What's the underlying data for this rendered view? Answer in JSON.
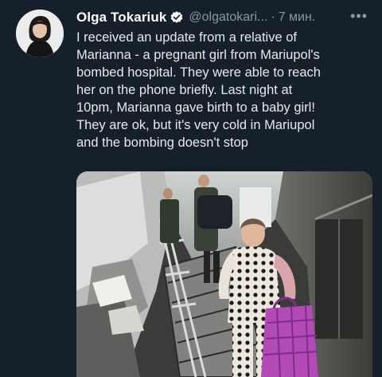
{
  "tweet": {
    "author_name": "Olga Tokariuk",
    "handle": "@olgatokari...",
    "separator": "·",
    "time": "7 мин.",
    "more_icon": "more-options-icon",
    "verified_icon": "verified-badge-icon",
    "text_lines": [
      "I received an update from a relative of",
      "Marianna - a pregnant girl from Mariupol's",
      "bombed hospital. They were able to reach",
      "her on the phone briefly. Last night at",
      "10pm, Marianna gave birth to a baby girl!",
      "They are ok, but it's very cold in Mariupol",
      "and the bombing doesn't stop"
    ]
  },
  "colors": {
    "background": "#15202b",
    "text": "#e7e9ea",
    "muted": "#8b98a5",
    "verified": "#1d9bf0"
  }
}
